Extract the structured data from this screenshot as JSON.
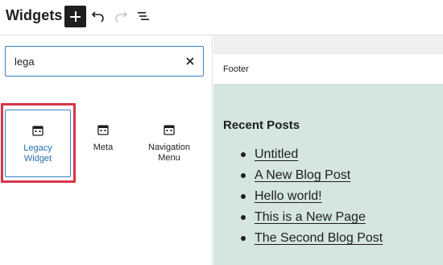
{
  "header": {
    "title": "Widgets",
    "icons": [
      "plus-icon",
      "undo-icon",
      "redo-icon",
      "list-view-icon"
    ]
  },
  "search": {
    "value": "lega",
    "icon": "close-icon"
  },
  "blocks": [
    {
      "label": "Legacy Widget",
      "icon": "calendar-icon",
      "selected": true
    },
    {
      "label": "Meta",
      "icon": "calendar-icon",
      "selected": false
    },
    {
      "label": "Navigation Menu",
      "icon": "calendar-icon",
      "selected": false
    }
  ],
  "canvas": {
    "area_label": "Footer",
    "widget_title": "Recent Posts",
    "posts": [
      "Untitled",
      "A New Blog Post",
      "Hello world!",
      "This is a New Page",
      "The Second Blog Post"
    ]
  },
  "colors": {
    "accent": "#2271b1",
    "highlight": "#d63649",
    "widget_bg": "#d4e6df"
  }
}
